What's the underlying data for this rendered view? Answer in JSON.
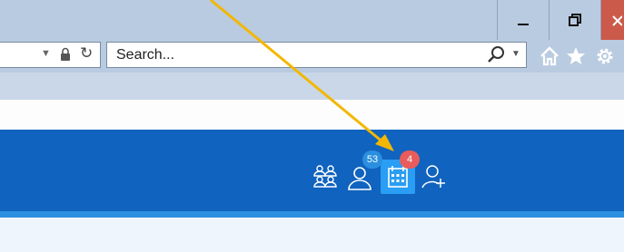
{
  "toolbar": {
    "search": {
      "placeholder": "Search..."
    }
  },
  "app_toolbar": {
    "badges": {
      "messages_count": "53",
      "calendar_count": "4"
    }
  },
  "colors": {
    "chrome": "#b9cbe0",
    "app_bar": "#1063be",
    "accent_tile": "#2a9df4",
    "badge_blue": "#2a8fe0",
    "badge_red": "#e85c5c",
    "close_button": "#cc5a4b",
    "annotation_arrow": "#f2b705"
  },
  "icons": {
    "window": [
      "minimize-icon",
      "restore-icon",
      "close-icon"
    ],
    "browser": [
      "dropdown-chevron-icon",
      "lock-icon",
      "refresh-icon",
      "search-icon",
      "home-icon",
      "favorites-star-icon",
      "settings-gear-icon"
    ],
    "app": [
      "groups-icon",
      "user-icon",
      "calendar-icon",
      "add-user-icon"
    ],
    "annotation": [
      "annotation-arrow"
    ]
  }
}
